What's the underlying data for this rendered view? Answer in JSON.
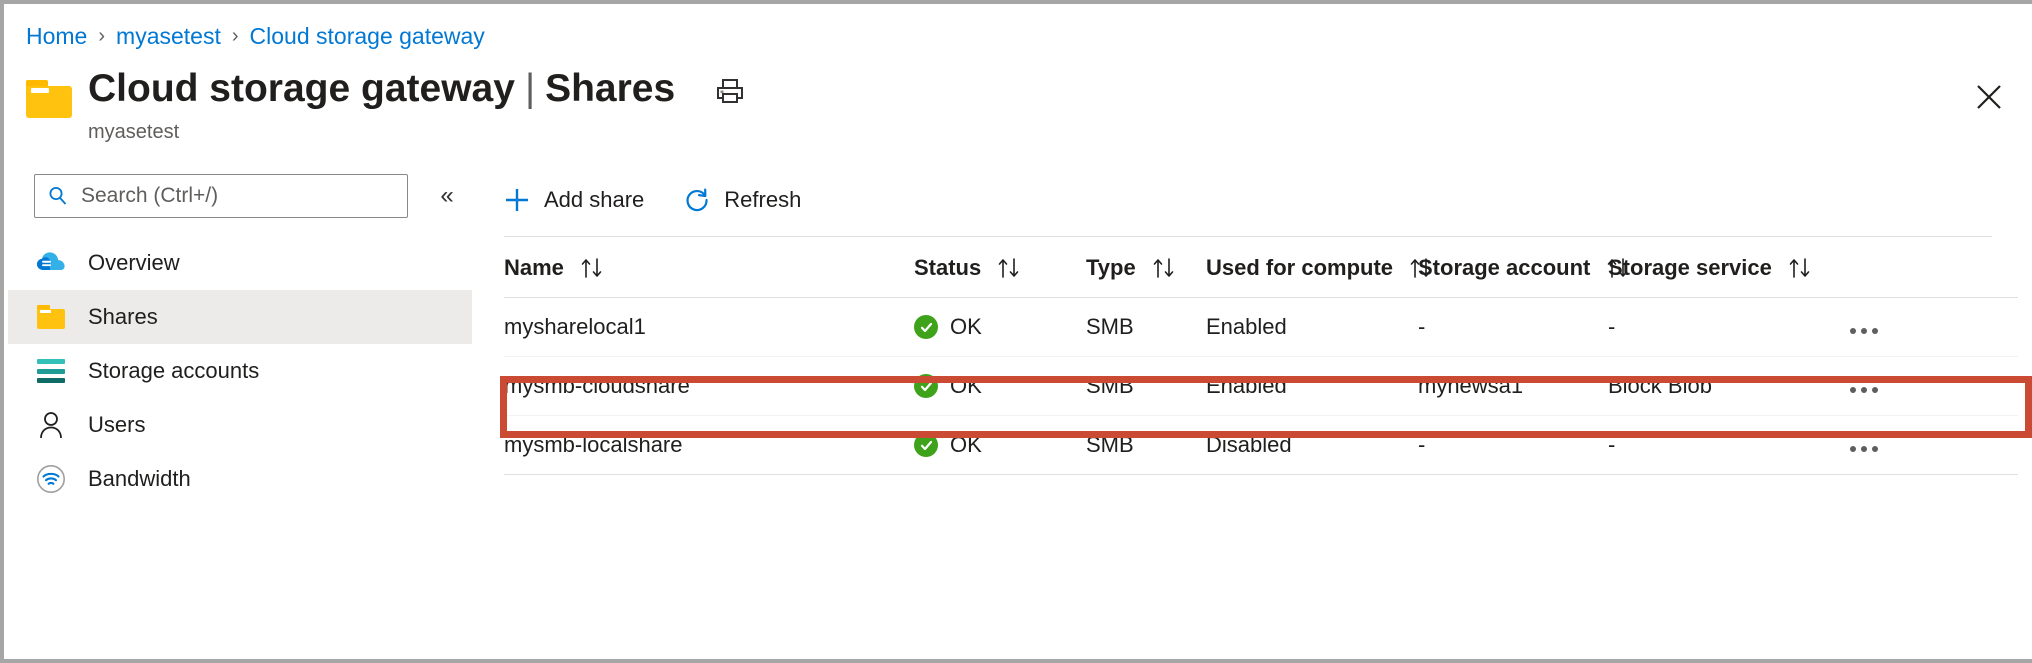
{
  "breadcrumb": {
    "items": [
      {
        "label": "Home"
      },
      {
        "label": "myasetest"
      },
      {
        "label": "Cloud storage gateway"
      }
    ],
    "separator": "›"
  },
  "header": {
    "icon": "folder-icon",
    "title": "Cloud storage gateway",
    "separator": "|",
    "section": "Shares",
    "subtitle": "myasetest",
    "print_icon": "print-icon",
    "close_icon": "close-icon"
  },
  "sidebar": {
    "search": {
      "placeholder": "Search (Ctrl+/)",
      "value": "",
      "icon": "search-icon"
    },
    "collapse": {
      "icon": "chevron-double-left-icon",
      "glyph": "«"
    },
    "items": [
      {
        "label": "Overview",
        "icon": "cloud-icon",
        "selected": false
      },
      {
        "label": "Shares",
        "icon": "folder-icon",
        "selected": true
      },
      {
        "label": "Storage accounts",
        "icon": "storage-account-icon",
        "selected": false
      },
      {
        "label": "Users",
        "icon": "user-icon",
        "selected": false
      },
      {
        "label": "Bandwidth",
        "icon": "bandwidth-icon",
        "selected": false
      }
    ]
  },
  "toolbar": {
    "buttons": [
      {
        "label": "Add share",
        "icon": "plus-icon"
      },
      {
        "label": "Refresh",
        "icon": "refresh-icon"
      }
    ]
  },
  "table": {
    "sort_icon": "sort-arrows-icon",
    "overflow_icon": "ellipsis-icon",
    "columns": [
      {
        "label": "Name",
        "sortable": true
      },
      {
        "label": "Status",
        "sortable": true
      },
      {
        "label": "Type",
        "sortable": true
      },
      {
        "label": "Used for compute",
        "sortable": true
      },
      {
        "label": "Storage account",
        "sortable": true
      },
      {
        "label": "Storage service",
        "sortable": true
      }
    ],
    "rows": [
      {
        "name": "mysharelocal1",
        "status": "OK",
        "status_icon": "check-circle-icon",
        "type": "SMB",
        "used_for_compute": "Enabled",
        "storage_account": "-",
        "storage_service": "-",
        "highlighted": false
      },
      {
        "name": "mysmb-cloudshare",
        "status": "OK",
        "status_icon": "check-circle-icon",
        "type": "SMB",
        "used_for_compute": "Enabled",
        "storage_account": "mynewsa1",
        "storage_service": "Block Blob",
        "highlighted": true
      },
      {
        "name": "mysmb-localshare",
        "status": "OK",
        "status_icon": "check-circle-icon",
        "type": "SMB",
        "used_for_compute": "Disabled",
        "storage_account": "-",
        "storage_service": "-",
        "highlighted": false
      }
    ]
  },
  "colors": {
    "link": "#0078d4",
    "accent": "#0078d4",
    "status_ok": "#3fa21b",
    "highlight_border": "#ca4a33",
    "folder": "#ffc20e",
    "selected_bg": "#edebe9"
  }
}
